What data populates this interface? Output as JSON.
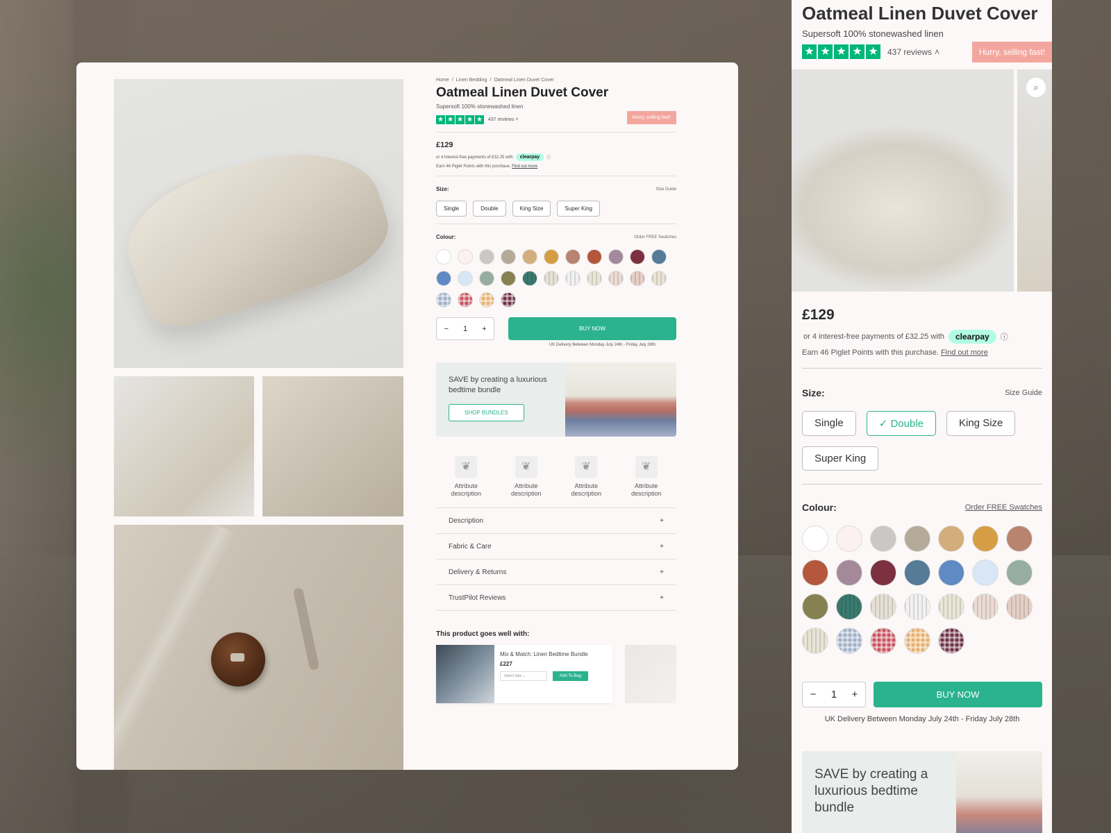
{
  "product": {
    "title": "Oatmeal Linen Duvet Cover",
    "subtitle": "Supersoft 100% stonewashed linen",
    "reviews": "437 reviews",
    "hurry": "Hurry, selling fast!",
    "price": "£129",
    "pay_text": "or 4 interest-free payments of £32.25 with",
    "clearpay": "clearpay",
    "points_text": "Earn 46 Piglet Points with this purchase.",
    "points_link": "Find out more",
    "size_label": "Size:",
    "size_guide": "Size Guide",
    "sizes": [
      "Single",
      "Double",
      "King Size",
      "Super King"
    ],
    "selected_size": "Double",
    "colour_label": "Colour:",
    "swatch_link": "Order FREE Swatches",
    "quantity": "1",
    "buy_now": "BUY NOW",
    "delivery": "UK Delivery Between Monday July 24th - Friday July 28th"
  },
  "desktop": {
    "breadcrumb": [
      "Home",
      "/",
      "Linen Bedding",
      "/",
      "Oatmeal Linen Duvet Cover"
    ],
    "bundle_text": "SAVE by creating a luxurious bedtime bundle",
    "shop_bundles": "SHOP BUNDLES",
    "attributes": [
      "Attribute description",
      "Attribute description",
      "Attribute description",
      "Attribute description"
    ],
    "accordion": [
      "Description",
      "Fabric & Care",
      "Delivery & Returns",
      "TrustPilot Reviews"
    ],
    "goes_well": "This product goes well with:",
    "rec_name": "Mix & Match: Linen Bedtime Bundle",
    "rec_price": "£227",
    "rec_select": "Select Size",
    "rec_add": "Add To Bag"
  },
  "mobile": {
    "bundle_text": "SAVE by creating a luxurious bedtime bundle"
  },
  "swatch_colors": [
    "#ffffff",
    "#fbf1f0",
    "#c9c8c5",
    "#b5a99a",
    "#d3ad7b",
    "#d59e45",
    "#b88470",
    "#b4573d",
    "#a4899a",
    "#7d3040",
    "#557b97",
    "#5f8ac3",
    "#d8e6f6",
    "#97ada2",
    "#878152",
    "#3a7a6f",
    "#e7e1d5",
    "#f2f2f2",
    "#e9e6d8",
    "#ecdcd4",
    "#e6cfc6",
    "#e9e4d6",
    "#9fb0c8",
    "#c8525e",
    "#e6b06e",
    "#6d3246"
  ],
  "colors": {
    "accent": "#2ab38e",
    "trustpilot": "#00b67a",
    "hurry": "#f3a69d",
    "clearpay": "#b2fce4"
  }
}
